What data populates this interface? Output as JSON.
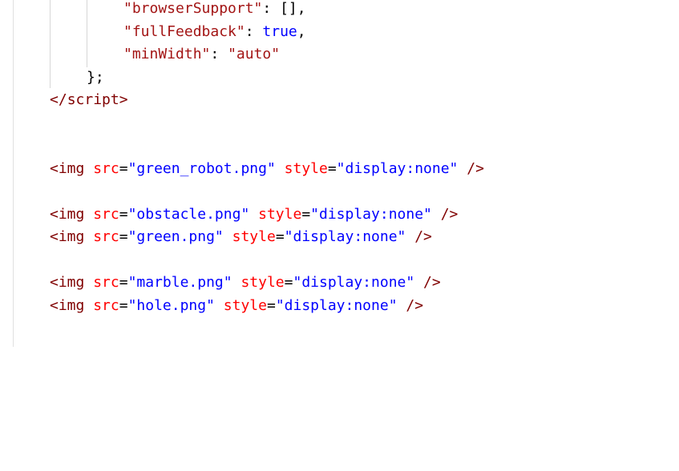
{
  "editor": {
    "lines": {
      "l1": {
        "key": "\"browserSupport\"",
        "sep": ": ",
        "val": "[]",
        "end": ","
      },
      "l2": {
        "key": "\"fullFeedback\"",
        "sep": ": ",
        "val": "true",
        "end": ","
      },
      "l3": {
        "key": "\"minWidth\"",
        "sep": ": ",
        "val": "\"auto\"",
        "end": ""
      },
      "l4": {
        "text": "};"
      },
      "l5": {
        "open": "</",
        "tag": "script",
        "close": ">"
      },
      "img1": {
        "src": "\"green_robot.png\"",
        "style": "\"display:none\""
      },
      "img2": {
        "src": "\"obstacle.png\"",
        "style": "\"display:none\""
      },
      "img3": {
        "src": "\"green.png\"",
        "style": "\"display:none\""
      },
      "img4": {
        "src": "\"marble.png\"",
        "style": "\"display:none\""
      },
      "img5": {
        "src": "\"hole.png\"",
        "style": "\"display:none\""
      },
      "common": {
        "lt": "<",
        "img": "img",
        "src_attr": "src",
        "style_attr": "style",
        "eq": "=",
        "selfclose": "/>"
      }
    }
  }
}
